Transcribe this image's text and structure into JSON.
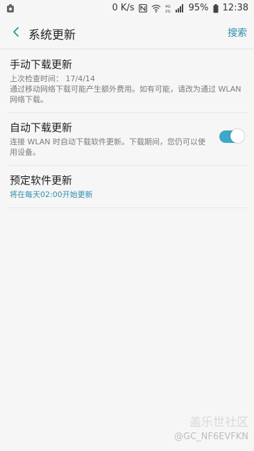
{
  "status_bar": {
    "speed": "0 K/s",
    "network": "4G",
    "battery": "95%",
    "time": "12:38"
  },
  "header": {
    "title": "系统更新",
    "search_label": "搜索"
  },
  "items": [
    {
      "title": "手动下载更新",
      "subtitle": "上次检查时间： 17/4/14",
      "description": "通过移动网络下载可能产生额外费用。如有可能，请改为通过 WLAN 网络下载。"
    },
    {
      "title": "自动下载更新",
      "description": "连接 WLAN 时自动下载软件更新。下载期间，您仍可以使用设备。",
      "toggle_on": true
    },
    {
      "title": "预定软件更新",
      "description": "将在每天02:00开始更新"
    }
  ],
  "watermark": {
    "brand": "盖乐世社区",
    "user": "@GC_NF6EVFKN"
  },
  "colors": {
    "accent": "#2f8fad",
    "toggle": "#3ea9c6",
    "background": "#f6f6f6"
  }
}
